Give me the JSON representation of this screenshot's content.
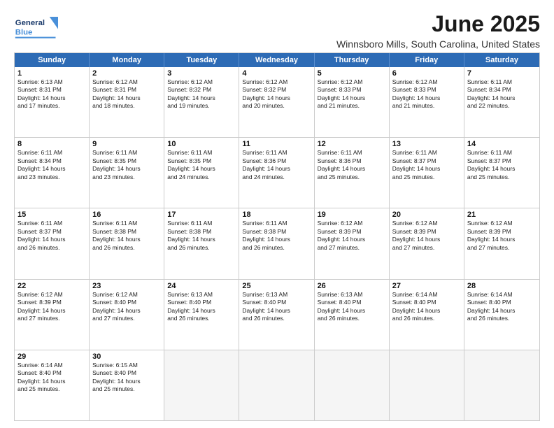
{
  "header": {
    "logo_general": "General",
    "logo_blue": "Blue",
    "main_title": "June 2025",
    "subtitle": "Winnsboro Mills, South Carolina, United States"
  },
  "calendar": {
    "days_of_week": [
      "Sunday",
      "Monday",
      "Tuesday",
      "Wednesday",
      "Thursday",
      "Friday",
      "Saturday"
    ],
    "weeks": [
      [
        {
          "num": "",
          "empty": true
        },
        {
          "num": "2",
          "rise": "Sunrise: 6:12 AM",
          "set": "Sunset: 8:31 PM",
          "day": "Daylight: 14 hours and 18 minutes."
        },
        {
          "num": "3",
          "rise": "Sunrise: 6:12 AM",
          "set": "Sunset: 8:32 PM",
          "day": "Daylight: 14 hours and 19 minutes."
        },
        {
          "num": "4",
          "rise": "Sunrise: 6:12 AM",
          "set": "Sunset: 8:32 PM",
          "day": "Daylight: 14 hours and 20 minutes."
        },
        {
          "num": "5",
          "rise": "Sunrise: 6:12 AM",
          "set": "Sunset: 8:33 PM",
          "day": "Daylight: 14 hours and 21 minutes."
        },
        {
          "num": "6",
          "rise": "Sunrise: 6:12 AM",
          "set": "Sunset: 8:33 PM",
          "day": "Daylight: 14 hours and 21 minutes."
        },
        {
          "num": "7",
          "rise": "Sunrise: 6:11 AM",
          "set": "Sunset: 8:34 PM",
          "day": "Daylight: 14 hours and 22 minutes."
        }
      ],
      [
        {
          "num": "8",
          "rise": "Sunrise: 6:11 AM",
          "set": "Sunset: 8:34 PM",
          "day": "Daylight: 14 hours and 23 minutes."
        },
        {
          "num": "9",
          "rise": "Sunrise: 6:11 AM",
          "set": "Sunset: 8:35 PM",
          "day": "Daylight: 14 hours and 23 minutes."
        },
        {
          "num": "10",
          "rise": "Sunrise: 6:11 AM",
          "set": "Sunset: 8:35 PM",
          "day": "Daylight: 14 hours and 24 minutes."
        },
        {
          "num": "11",
          "rise": "Sunrise: 6:11 AM",
          "set": "Sunset: 8:36 PM",
          "day": "Daylight: 14 hours and 24 minutes."
        },
        {
          "num": "12",
          "rise": "Sunrise: 6:11 AM",
          "set": "Sunset: 8:36 PM",
          "day": "Daylight: 14 hours and 25 minutes."
        },
        {
          "num": "13",
          "rise": "Sunrise: 6:11 AM",
          "set": "Sunset: 8:37 PM",
          "day": "Daylight: 14 hours and 25 minutes."
        },
        {
          "num": "14",
          "rise": "Sunrise: 6:11 AM",
          "set": "Sunset: 8:37 PM",
          "day": "Daylight: 14 hours and 25 minutes."
        }
      ],
      [
        {
          "num": "15",
          "rise": "Sunrise: 6:11 AM",
          "set": "Sunset: 8:37 PM",
          "day": "Daylight: 14 hours and 26 minutes."
        },
        {
          "num": "16",
          "rise": "Sunrise: 6:11 AM",
          "set": "Sunset: 8:38 PM",
          "day": "Daylight: 14 hours and 26 minutes."
        },
        {
          "num": "17",
          "rise": "Sunrise: 6:11 AM",
          "set": "Sunset: 8:38 PM",
          "day": "Daylight: 14 hours and 26 minutes."
        },
        {
          "num": "18",
          "rise": "Sunrise: 6:11 AM",
          "set": "Sunset: 8:38 PM",
          "day": "Daylight: 14 hours and 26 minutes."
        },
        {
          "num": "19",
          "rise": "Sunrise: 6:12 AM",
          "set": "Sunset: 8:39 PM",
          "day": "Daylight: 14 hours and 27 minutes."
        },
        {
          "num": "20",
          "rise": "Sunrise: 6:12 AM",
          "set": "Sunset: 8:39 PM",
          "day": "Daylight: 14 hours and 27 minutes."
        },
        {
          "num": "21",
          "rise": "Sunrise: 6:12 AM",
          "set": "Sunset: 8:39 PM",
          "day": "Daylight: 14 hours and 27 minutes."
        }
      ],
      [
        {
          "num": "22",
          "rise": "Sunrise: 6:12 AM",
          "set": "Sunset: 8:39 PM",
          "day": "Daylight: 14 hours and 27 minutes."
        },
        {
          "num": "23",
          "rise": "Sunrise: 6:12 AM",
          "set": "Sunset: 8:40 PM",
          "day": "Daylight: 14 hours and 27 minutes."
        },
        {
          "num": "24",
          "rise": "Sunrise: 6:13 AM",
          "set": "Sunset: 8:40 PM",
          "day": "Daylight: 14 hours and 26 minutes."
        },
        {
          "num": "25",
          "rise": "Sunrise: 6:13 AM",
          "set": "Sunset: 8:40 PM",
          "day": "Daylight: 14 hours and 26 minutes."
        },
        {
          "num": "26",
          "rise": "Sunrise: 6:13 AM",
          "set": "Sunset: 8:40 PM",
          "day": "Daylight: 14 hours and 26 minutes."
        },
        {
          "num": "27",
          "rise": "Sunrise: 6:14 AM",
          "set": "Sunset: 8:40 PM",
          "day": "Daylight: 14 hours and 26 minutes."
        },
        {
          "num": "28",
          "rise": "Sunrise: 6:14 AM",
          "set": "Sunset: 8:40 PM",
          "day": "Daylight: 14 hours and 26 minutes."
        }
      ],
      [
        {
          "num": "29",
          "rise": "Sunrise: 6:14 AM",
          "set": "Sunset: 8:40 PM",
          "day": "Daylight: 14 hours and 25 minutes."
        },
        {
          "num": "30",
          "rise": "Sunrise: 6:15 AM",
          "set": "Sunset: 8:40 PM",
          "day": "Daylight: 14 hours and 25 minutes."
        },
        {
          "num": "",
          "empty": true
        },
        {
          "num": "",
          "empty": true
        },
        {
          "num": "",
          "empty": true
        },
        {
          "num": "",
          "empty": true
        },
        {
          "num": "",
          "empty": true
        }
      ]
    ],
    "week1_sun": {
      "num": "1",
      "rise": "Sunrise: 6:13 AM",
      "set": "Sunset: 8:31 PM",
      "day": "Daylight: 14 hours and 17 minutes."
    }
  }
}
